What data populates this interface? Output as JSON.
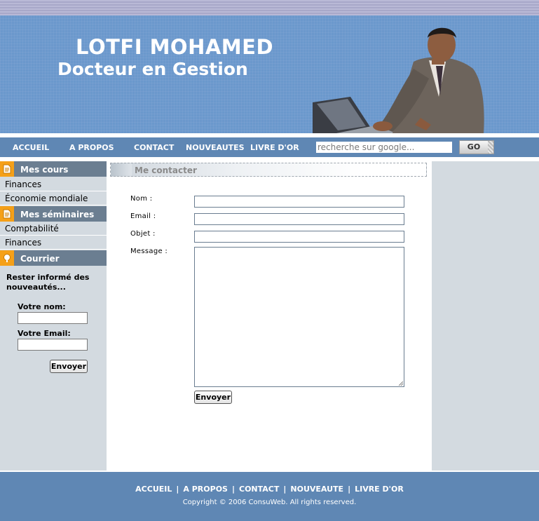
{
  "header": {
    "name": "LOTFI MOHAMED",
    "subtitle": "Docteur en Gestion"
  },
  "nav": {
    "items": [
      "ACCUEIL",
      "A PROPOS",
      "CONTACT",
      "NOUVEAUTES",
      "LIVRE D'OR"
    ],
    "search_placeholder": "recherche sur google...",
    "go_label": "GO"
  },
  "sidebar": {
    "sections": [
      {
        "title": "Mes cours",
        "icon": "document-icon",
        "items": [
          "Finances",
          "Économie mondiale"
        ]
      },
      {
        "title": "Mes séminaires",
        "icon": "document-icon",
        "items": [
          "Comptabilité",
          "Finances"
        ]
      },
      {
        "title": "Courrier",
        "icon": "mail-icon",
        "items": []
      }
    ],
    "newsletter": {
      "intro": "Rester informé des nouveautés...",
      "name_label": "Votre nom:",
      "email_label": "Votre Email:",
      "submit_label": "Envoyer"
    }
  },
  "content": {
    "title": "Me contacter",
    "form": {
      "nom_label": "Nom :",
      "email_label": "Email :",
      "objet_label": "Objet :",
      "message_label": "Message :",
      "submit_label": "Envoyer"
    }
  },
  "footer": {
    "links": [
      "ACCUEIL",
      "A PROPOS",
      "CONTACT",
      "NOUVEAUTE",
      "LIVRE D'OR"
    ],
    "separator": "|",
    "copyright": "Copyright © 2006 ConsuWeb. All rights reserved."
  },
  "colors": {
    "banner": "#6b98cc",
    "navbar": "#5f87b4",
    "sidebar_header": "#6b7e91",
    "accent_icon": "#f5a018",
    "panel": "#d3dae0"
  }
}
